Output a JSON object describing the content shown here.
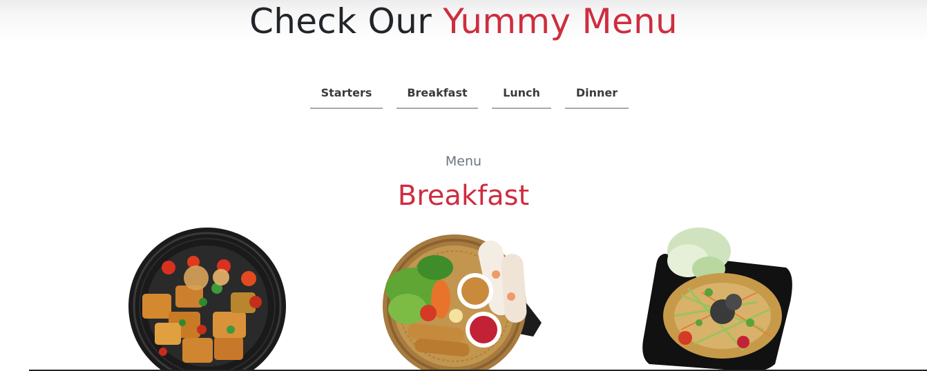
{
  "header": {
    "title_part1": "Check Our",
    "title_part2": "Yummy Menu"
  },
  "tabs": [
    {
      "label": "Starters"
    },
    {
      "label": "Breakfast"
    },
    {
      "label": "Lunch"
    },
    {
      "label": "Dinner"
    }
  ],
  "menu_section": {
    "subtitle": "Menu",
    "heading": "Breakfast"
  },
  "dishes": [
    {
      "image": "stir-fried-tofu-bowl"
    },
    {
      "image": "spring-rolls-basket"
    },
    {
      "image": "papaya-salad-plate"
    }
  ],
  "colors": {
    "accent": "#ce2d3f",
    "text": "#212529",
    "muted": "#6c757d"
  }
}
